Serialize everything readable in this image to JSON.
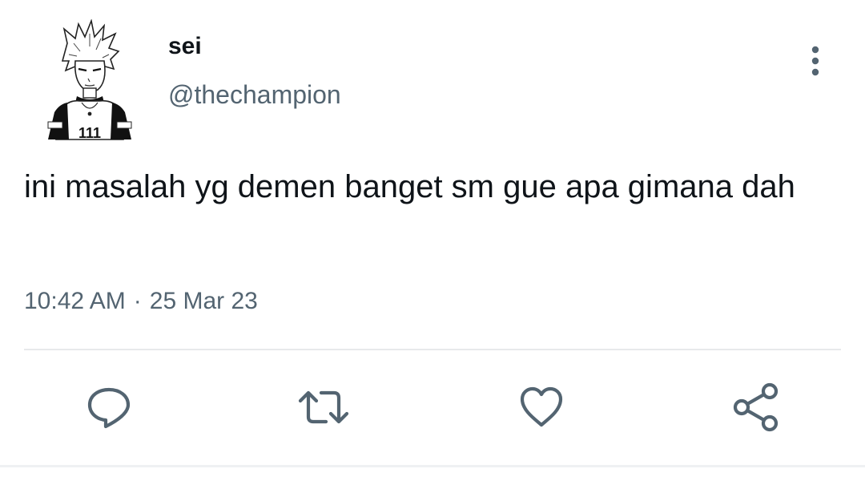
{
  "user": {
    "display_name": "sei",
    "handle": "@thechampion",
    "avatar_jersey_number": "111"
  },
  "tweet": {
    "text": "ini masalah yg demen banget sm gue apa gimana dah",
    "time": "10:42 AM",
    "separator": "·",
    "date": "25 Mar 23"
  },
  "actions": {
    "reply_icon": "reply-icon",
    "retweet_icon": "retweet-icon",
    "like_icon": "like-icon",
    "share_icon": "share-icon",
    "more_icon": "more-vertical-icon"
  },
  "colors": {
    "text_primary": "#0f1419",
    "text_secondary": "#536471",
    "icon": "#536471",
    "divider": "#e7e9eb"
  }
}
